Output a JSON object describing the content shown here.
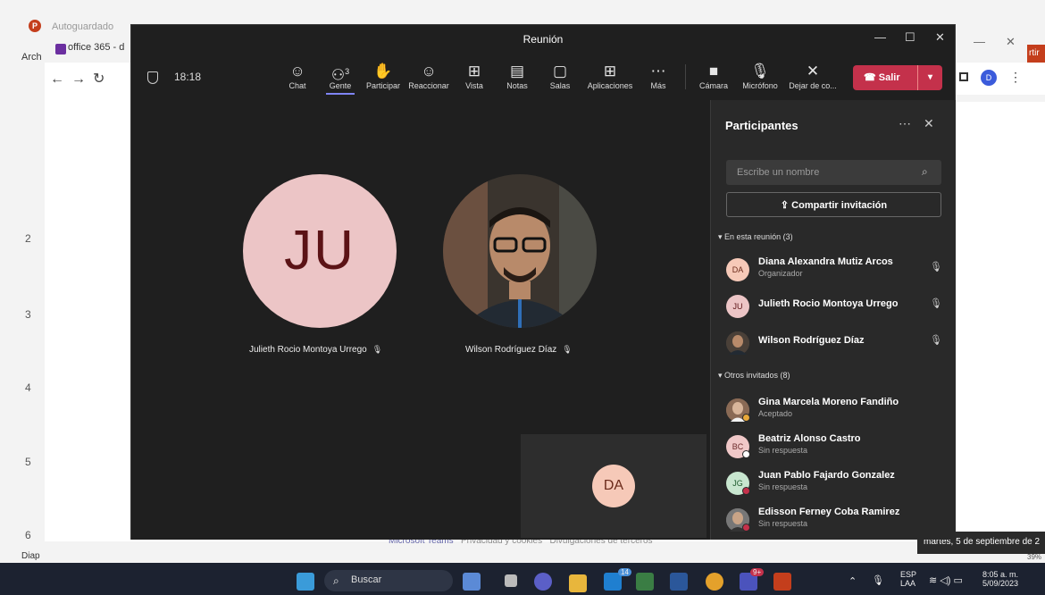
{
  "background_app": {
    "autosave_label": "Autoguardado",
    "ribbon_tab": "Arch",
    "slide_numbers": [
      "2",
      "3",
      "4",
      "5",
      "6"
    ],
    "status_left": "Diap",
    "zoom_partial": "39%",
    "browser_tab_title": "office 365 - d",
    "browser_action_partial": "rtir",
    "profile_initial": "D"
  },
  "teams_window": {
    "title": "Reunión",
    "timer": "18:18",
    "toolbar": [
      {
        "label": "Chat",
        "icon": "chat-icon",
        "glyph": "☺"
      },
      {
        "label": "Gente",
        "icon": "people-icon",
        "glyph": "⚇",
        "count": "3",
        "active": true
      },
      {
        "label": "Participar",
        "icon": "raise-hand-icon",
        "glyph": "✋"
      },
      {
        "label": "Reaccionar",
        "icon": "react-icon",
        "glyph": "☺"
      },
      {
        "label": "Vista",
        "icon": "view-icon",
        "glyph": "⊞"
      },
      {
        "label": "Notas",
        "icon": "notes-icon",
        "glyph": "▤"
      },
      {
        "label": "Salas",
        "icon": "rooms-icon",
        "glyph": "▢"
      },
      {
        "label": "Aplicaciones",
        "icon": "apps-icon",
        "glyph": "⊞"
      },
      {
        "label": "Más",
        "icon": "more-icon",
        "glyph": "⋯"
      },
      {
        "label": "Cámara",
        "icon": "camera-off-icon",
        "glyph": "■"
      },
      {
        "label": "Micrófono",
        "icon": "mic-off-icon",
        "glyph": "🎙"
      },
      {
        "label": "Dejar de co...",
        "icon": "stop-share-icon",
        "glyph": "✕"
      }
    ],
    "leave_label": "Salir",
    "stage": {
      "tile1": {
        "initials": "JU",
        "name": "Julieth Rocio Montoya Urrego"
      },
      "tile2": {
        "name": "Wilson Rodríguez Díaz"
      },
      "self_initials": "DA"
    },
    "participants": {
      "title": "Participantes",
      "search_placeholder": "Escribe un nombre",
      "share_label": "Compartir invitación",
      "in_meeting_header": "En esta reunión (3)",
      "others_header": "Otros invitados (8)",
      "in_meeting": [
        {
          "initials": "DA",
          "name": "Diana Alexandra Mutiz Arcos",
          "role": "Organizador",
          "avatar_bg": "#f6c9b8",
          "avatar_fg": "#6b2a1a"
        },
        {
          "initials": "JU",
          "name": "Julieth Rocio Montoya Urrego",
          "role": "",
          "avatar_bg": "#ecc5c6",
          "avatar_fg": "#5b1316"
        },
        {
          "initials": "",
          "name": "Wilson Rodríguez Díaz",
          "role": "",
          "avatar_bg": "#4a4a4a",
          "avatar_fg": "#fff"
        }
      ],
      "others": [
        {
          "initials": "",
          "name": "Gina Marcela Moreno Fandiño",
          "status": "Aceptado",
          "avatar_bg": "#8a6a55",
          "dot": "#e8a83a"
        },
        {
          "initials": "BC",
          "name": "Beatriz Alonso Castro",
          "status": "Sin respuesta",
          "avatar_bg": "#f0c8c8",
          "dot": "#ffffff"
        },
        {
          "initials": "JG",
          "name": "Juan Pablo Fajardo Gonzalez",
          "status": "Sin respuesta",
          "avatar_bg": "#c8e6cf",
          "dot": "#c4314b"
        },
        {
          "initials": "",
          "name": "Edisson Ferney Coba Ramirez",
          "status": "Sin respuesta",
          "avatar_bg": "#777777",
          "dot": "#c4314b"
        }
      ]
    }
  },
  "footer": {
    "brand": "Microsoft Teams",
    "privacy": "Privacidad y cookies",
    "third_party": "Divulgaciones de terceros"
  },
  "tooltip": "martes, 5 de septiembre de 2",
  "taskbar": {
    "search_placeholder": "Buscar",
    "lang_top": "ESP",
    "lang_bottom": "LAA",
    "time": "8:05 a. m.",
    "date": "5/09/2023",
    "badges": {
      "mail": "14",
      "teams": "9+"
    }
  },
  "colors": {
    "teams_bg": "#1f1f1f",
    "panel_bg": "#292929",
    "leave_red": "#c4314b",
    "accent": "#7f85f5"
  }
}
